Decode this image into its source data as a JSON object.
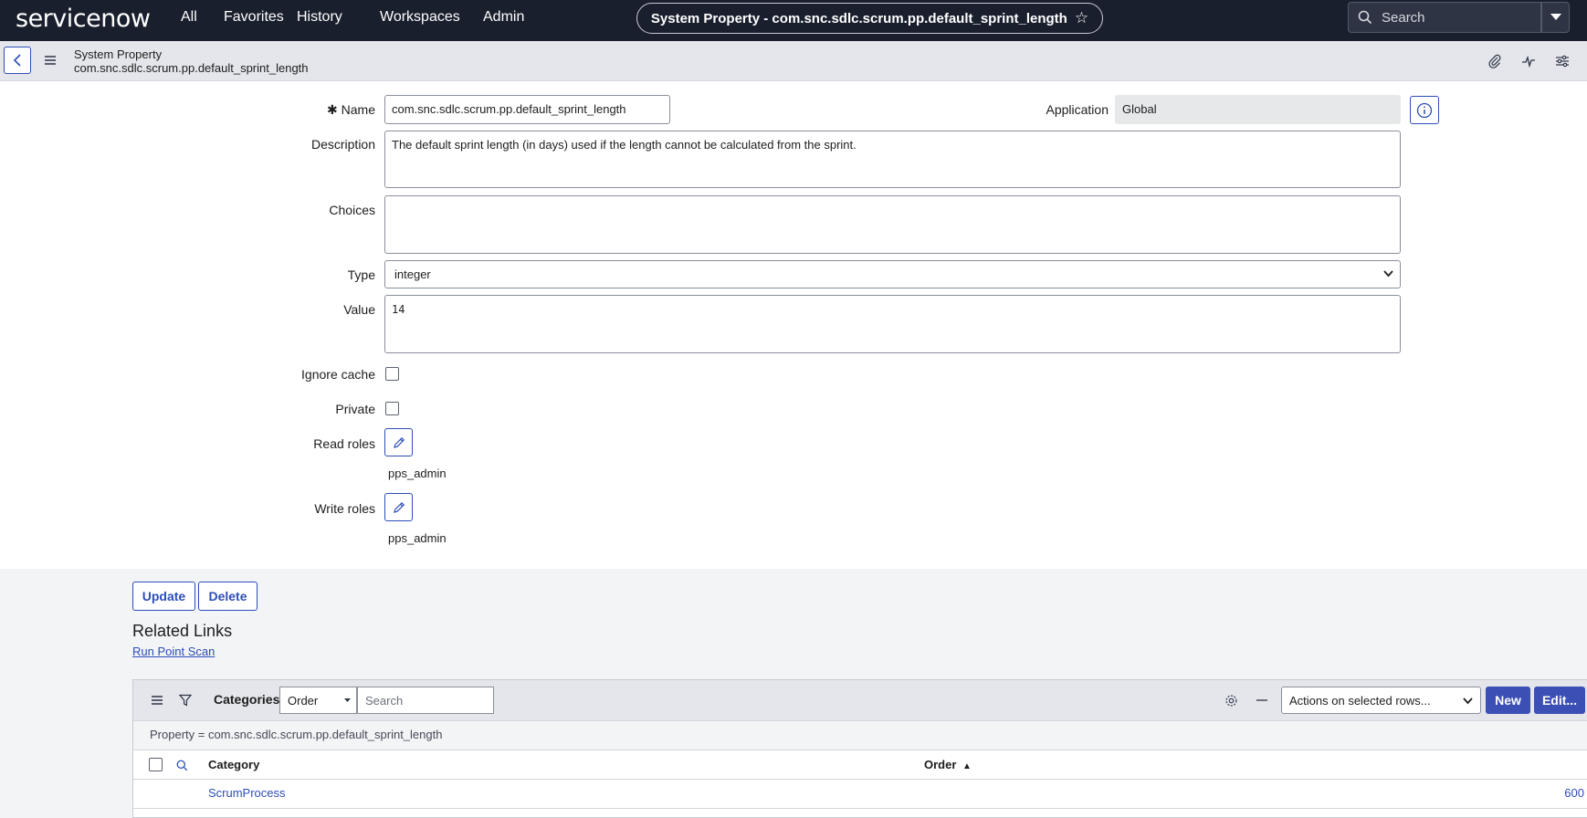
{
  "topbar": {
    "logo": "servicenow",
    "nav": [
      "All",
      "Favorites",
      "History",
      "Workspaces",
      "Admin"
    ],
    "record_title": "System Property - com.snc.sdlc.scrum.pp.default_sprint_length",
    "star_icon": "star-outline-icon",
    "search_placeholder": "Search"
  },
  "form_header": {
    "title": "System Property",
    "subtitle": "com.snc.sdlc.scrum.pp.default_sprint_length"
  },
  "form": {
    "name_label": "Name",
    "name_required_mark": "✱",
    "name_value": "com.snc.sdlc.scrum.pp.default_sprint_length",
    "application_label": "Application",
    "application_value": "Global",
    "description_label": "Description",
    "description_value": "The default sprint length (in days) used if the length cannot be calculated from the sprint.",
    "choices_label": "Choices",
    "choices_value": "",
    "type_label": "Type",
    "type_value": "integer",
    "value_label": "Value",
    "value_value": "14",
    "ignore_cache_label": "Ignore cache",
    "ignore_cache_checked": false,
    "private_label": "Private",
    "private_checked": false,
    "read_roles_label": "Read roles",
    "read_roles_value": "pps_admin",
    "write_roles_label": "Write roles",
    "write_roles_value": "pps_admin"
  },
  "actions": {
    "update": "Update",
    "delete": "Delete"
  },
  "related_links": {
    "title": "Related Links",
    "links": [
      "Run Point Scan"
    ]
  },
  "related_list": {
    "title": "Categories",
    "search_field": "Order",
    "search_placeholder": "Search",
    "filter_text": "Property = com.snc.sdlc.scrum.pp.default_sprint_length",
    "actions_select": "Actions on selected rows...",
    "new_label": "New",
    "edit_label": "Edit...",
    "columns": [
      "Category",
      "Order"
    ],
    "sort_indicator": "▲",
    "rows": [
      {
        "category": "ScrumProcess",
        "order": "600"
      }
    ]
  },
  "colors": {
    "topbar_bg": "#1a1f2e",
    "accent": "#2d4db8",
    "primary_button": "#3c4fb5"
  }
}
